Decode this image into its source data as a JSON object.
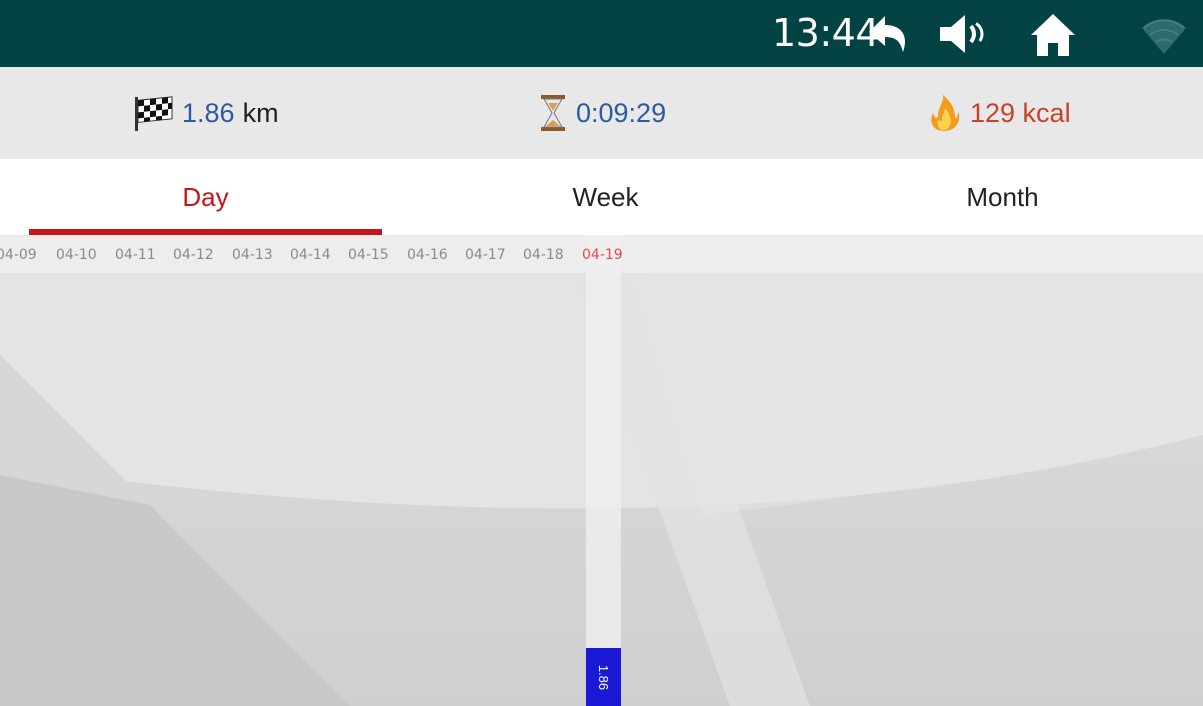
{
  "status_bar": {
    "time": "13:44",
    "icons": [
      "back-icon",
      "volume-icon",
      "home-icon",
      "wifi-icon"
    ],
    "background_color": "#044343"
  },
  "summary": {
    "distance": {
      "icon": "checkered-flag-icon",
      "value": "1.86",
      "unit": "km"
    },
    "duration": {
      "icon": "hourglass-icon",
      "value": "0:09:29"
    },
    "calories": {
      "icon": "fire-icon",
      "value": "129 kcal"
    }
  },
  "tabs": [
    {
      "label": "Day",
      "active": true
    },
    {
      "label": "Week",
      "active": false
    },
    {
      "label": "Month",
      "active": false
    }
  ],
  "chart_data": {
    "type": "bar",
    "categories": [
      "04-09",
      "04-10",
      "04-11",
      "04-12",
      "04-13",
      "04-14",
      "04-15",
      "04-16",
      "04-17",
      "04-18",
      "04-19"
    ],
    "values": [
      null,
      null,
      null,
      null,
      null,
      null,
      null,
      null,
      null,
      null,
      1.86
    ],
    "value_labels": [
      "",
      "",
      "",
      "",
      "",
      "",
      "",
      "",
      "",
      "",
      "1.86"
    ],
    "selected_category": "04-19",
    "bar_color": "#1a1ad6",
    "selected_label_color": "#f0434c",
    "ylim": [
      0,
      14
    ]
  }
}
